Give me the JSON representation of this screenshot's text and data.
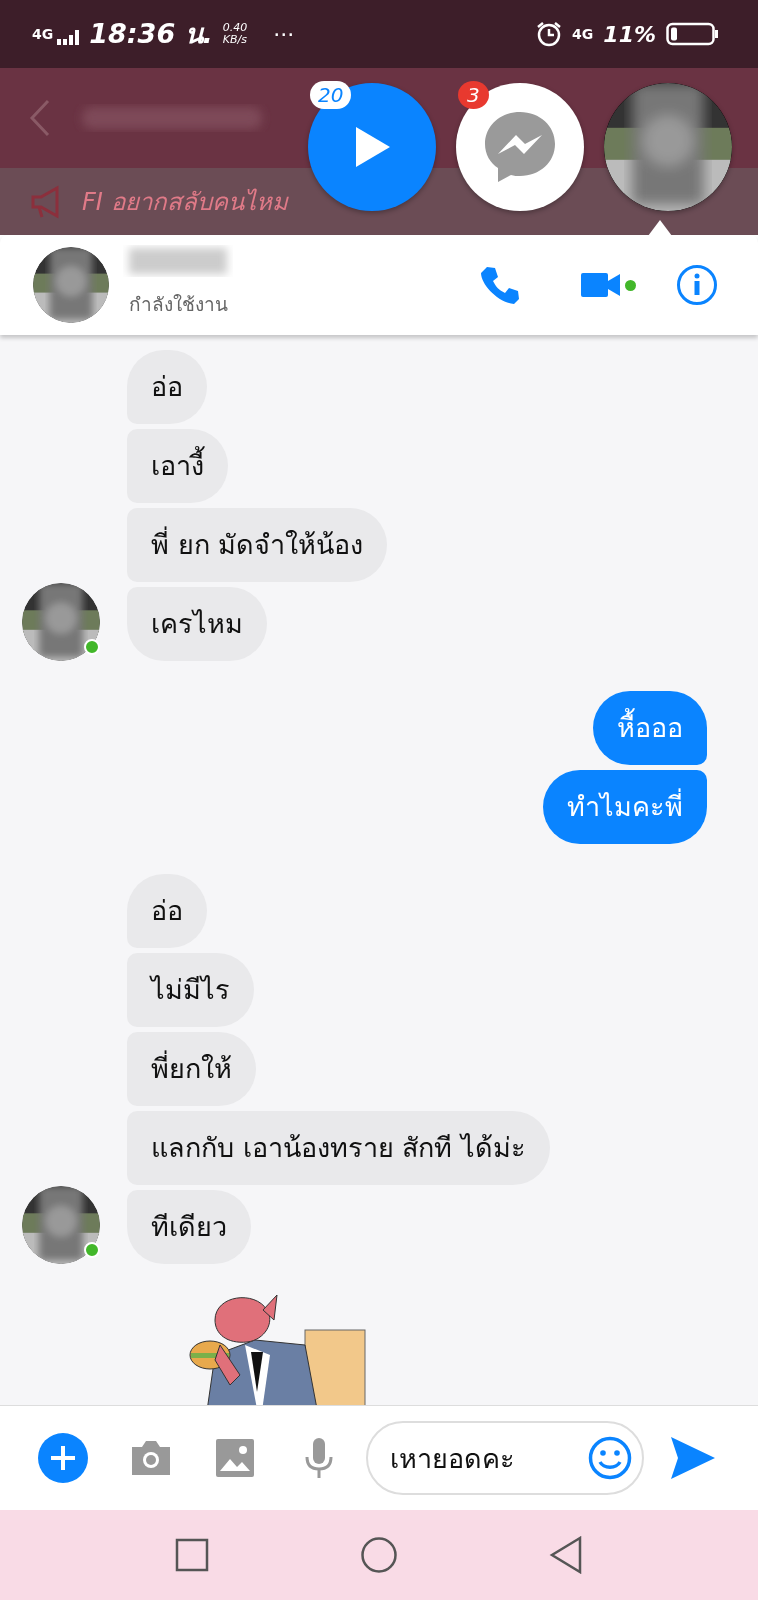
{
  "status_bar": {
    "network_left": "4G",
    "time": "18:36 น.",
    "speed": "0.40",
    "speed_unit": "KB/s",
    "more": "···",
    "network_right": "4G",
    "battery": "11%"
  },
  "background_app": {
    "banner": "FI อยากสลับคนไหม"
  },
  "chat_heads": [
    {
      "kind": "video",
      "badge": "20"
    },
    {
      "kind": "messenger",
      "badge": "3"
    },
    {
      "kind": "contact"
    }
  ],
  "conversation": {
    "status": "กำลังใช้งาน",
    "video_online": true
  },
  "messages": [
    {
      "outgoing": false,
      "avatar_online": true,
      "bubbles": [
        "อ่อ",
        "เอางี้",
        "พี่ ยก มัดจำให้น้อง",
        "เครไหม"
      ]
    },
    {
      "outgoing": true,
      "bubbles": [
        "หื้อออ",
        "ทำไมคะพี่"
      ]
    },
    {
      "outgoing": false,
      "avatar_online": true,
      "bubbles": [
        "อ่อ",
        "ไม่มีไร",
        "พี่ยกให้",
        "แลกกับ เอาน้องทราย สักที ได้ม่ะ",
        "ทีเดียว"
      ]
    },
    {
      "outgoing": false,
      "kind": "sticker"
    }
  ],
  "composer": {
    "value": "เหายอดคะ"
  }
}
